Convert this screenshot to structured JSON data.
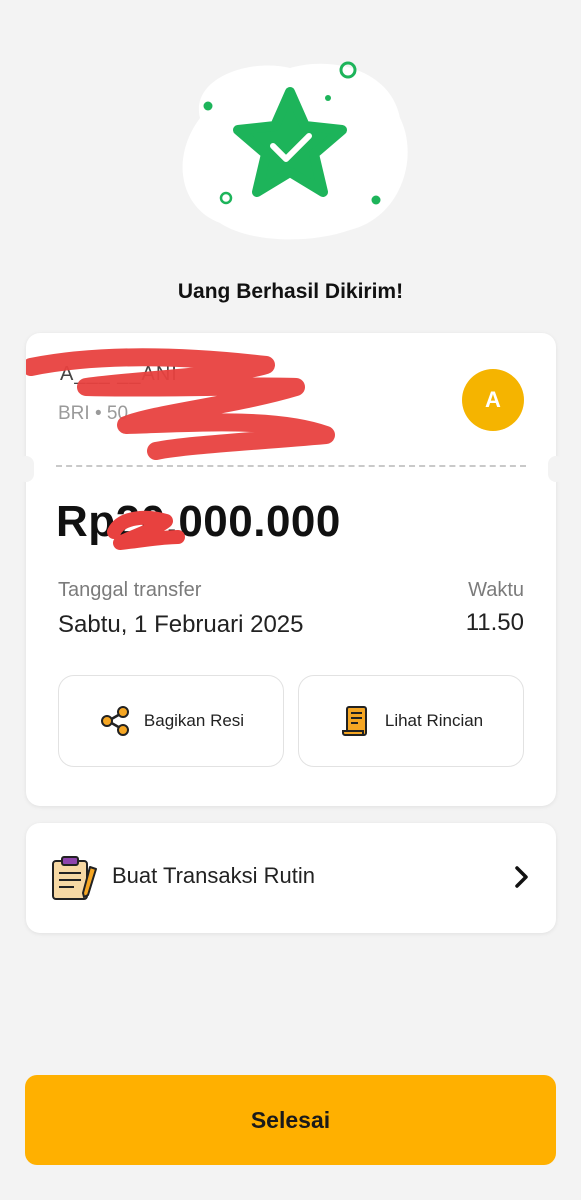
{
  "page": {
    "title": "Uang Berhasil Dikirim!",
    "colors": {
      "accent": "#ffb000",
      "success": "#1db45a",
      "avatar": "#f5b400"
    }
  },
  "recipient": {
    "name": "A___ __ANI",
    "bank": "BRI • 50",
    "avatar_initial": "A"
  },
  "transfer": {
    "amount": "Rp20.000.000",
    "date_label": "Tanggal transfer",
    "date_value": "Sabtu, 1 Februari 2025",
    "time_label": "Waktu",
    "time_value": "11.50"
  },
  "actions": {
    "share_label": "Bagikan Resi",
    "share_icon": "share-icon",
    "detail_label": "Lihat Rincian",
    "detail_icon": "receipt-icon"
  },
  "routine": {
    "label": "Buat Transaksi Rutin",
    "icon": "clipboard-icon"
  },
  "footer": {
    "done_label": "Selesai"
  }
}
